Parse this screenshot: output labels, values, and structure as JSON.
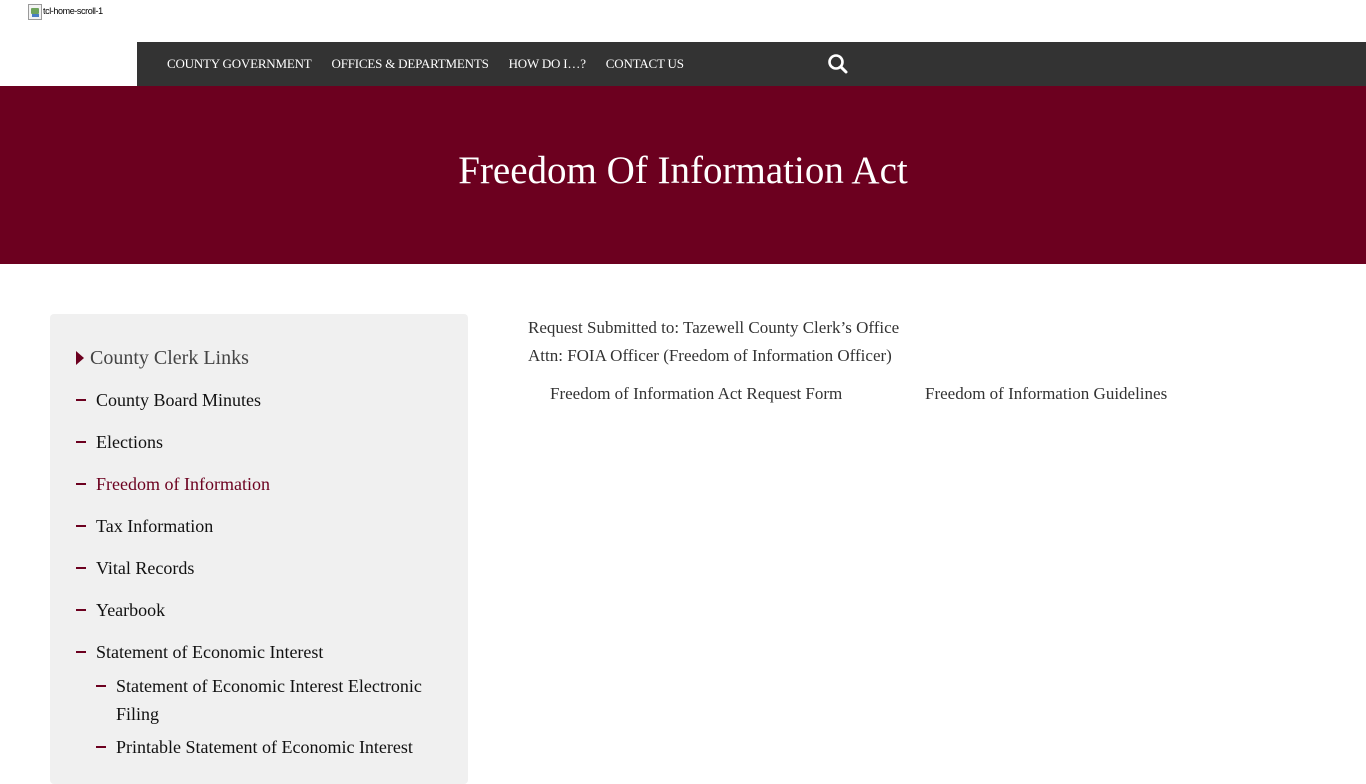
{
  "header": {
    "logo_alt": "tcl-home-scroll-1",
    "nav": [
      {
        "label": "COUNTY GOVERNMENT"
      },
      {
        "label": "OFFICES & DEPARTMENTS"
      },
      {
        "label": "HOW DO I…?"
      },
      {
        "label": "CONTACT US"
      }
    ],
    "search_icon": "search-icon"
  },
  "hero": {
    "title": "Freedom Of Information Act"
  },
  "sidebar": {
    "heading": "County Clerk Links",
    "items": [
      {
        "label": "County Board Minutes"
      },
      {
        "label": "Elections"
      },
      {
        "label": "Freedom of Information"
      },
      {
        "label": "Tax Information"
      },
      {
        "label": "Vital Records"
      },
      {
        "label": "Yearbook"
      },
      {
        "label": "Statement of Economic Interest"
      }
    ],
    "sub_items": [
      {
        "label": "Statement of Economic Interest Electronic Filing"
      },
      {
        "label": "Printable Statement of Economic Interest"
      }
    ]
  },
  "content": {
    "line1": "Request Submitted to: Tazewell County Clerk’s Office",
    "line2": "Attn: FOIA Officer (Freedom of Information Officer)",
    "links": [
      {
        "label": "Freedom of Information Act Request Form"
      },
      {
        "label": "Freedom of Information Guidelines"
      }
    ]
  },
  "colors": {
    "brand": "#6c001f",
    "navbar": "#333333",
    "sidebar_bg": "#f0f0f0"
  }
}
